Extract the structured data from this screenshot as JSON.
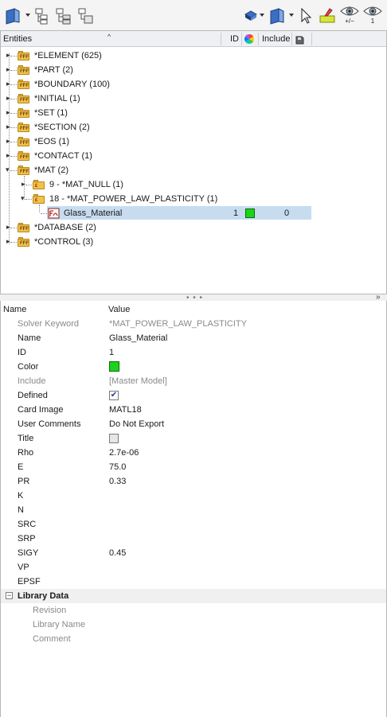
{
  "tree_header": {
    "entities_label": "Entities",
    "id_label": "ID",
    "include_label": "Include"
  },
  "tree": {
    "items": [
      {
        "label": "*ELEMENT  (625)"
      },
      {
        "label": "*PART  (2)"
      },
      {
        "label": "*BOUNDARY  (100)"
      },
      {
        "label": "*INITIAL  (1)"
      },
      {
        "label": "*SET  (1)"
      },
      {
        "label": "*SECTION  (2)"
      },
      {
        "label": "*EOS  (1)"
      },
      {
        "label": "*CONTACT  (1)"
      },
      {
        "label": "*MAT  (2)"
      },
      {
        "label": "9 - *MAT_NULL  (1)"
      },
      {
        "label": "18 - *MAT_POWER_LAW_PLASTICITY  (1)"
      },
      {
        "label": "Glass_Material"
      },
      {
        "label": "*DATABASE  (2)"
      },
      {
        "label": "*CONTROL  (3)"
      }
    ],
    "selected": {
      "id": "1",
      "include": "0",
      "color": "#1cd31c"
    }
  },
  "splitter": {
    "grip": "• • •"
  },
  "props_header": {
    "name_label": "Name",
    "value_label": "Value"
  },
  "props": [
    {
      "name": "Solver Keyword",
      "value": "*MAT_POWER_LAW_PLASTICITY"
    },
    {
      "name": "Name",
      "value": "Glass_Material"
    },
    {
      "name": "ID",
      "value": "1"
    },
    {
      "name": "Color",
      "value": ""
    },
    {
      "name": "Include",
      "value": "[Master Model]"
    },
    {
      "name": "Defined",
      "value": "✔"
    },
    {
      "name": "Card Image",
      "value": "MATL18"
    },
    {
      "name": "User Comments",
      "value": "Do Not Export"
    },
    {
      "name": "Title",
      "value": ""
    },
    {
      "name": "Rho",
      "value": "2.7e-06"
    },
    {
      "name": "E",
      "value": "75.0"
    },
    {
      "name": "PR",
      "value": "0.33"
    },
    {
      "name": "K",
      "value": ""
    },
    {
      "name": "N",
      "value": ""
    },
    {
      "name": "SRC",
      "value": ""
    },
    {
      "name": "SRP",
      "value": ""
    },
    {
      "name": "SIGY",
      "value": "0.45"
    },
    {
      "name": "VP",
      "value": ""
    },
    {
      "name": "EPSF",
      "value": ""
    }
  ],
  "library": {
    "title": "Library Data",
    "items": [
      {
        "name": "Revision"
      },
      {
        "name": "Library Name"
      },
      {
        "name": "Comment"
      }
    ]
  },
  "toolbar": {
    "icons": [
      "entity-view-icon",
      "entity-list-icon",
      "organize-icon",
      "tree-icon",
      "visibility-layer-icon",
      "entity-view-right-icon",
      "pointer-icon",
      "highlight-icon",
      "show-hide-toggle-icon",
      "show-only-icon"
    ],
    "plus_minus": "+/−",
    "one": "1"
  },
  "colors": {
    "accent_green": "#1cd31c",
    "selection": "#c7dcef"
  }
}
